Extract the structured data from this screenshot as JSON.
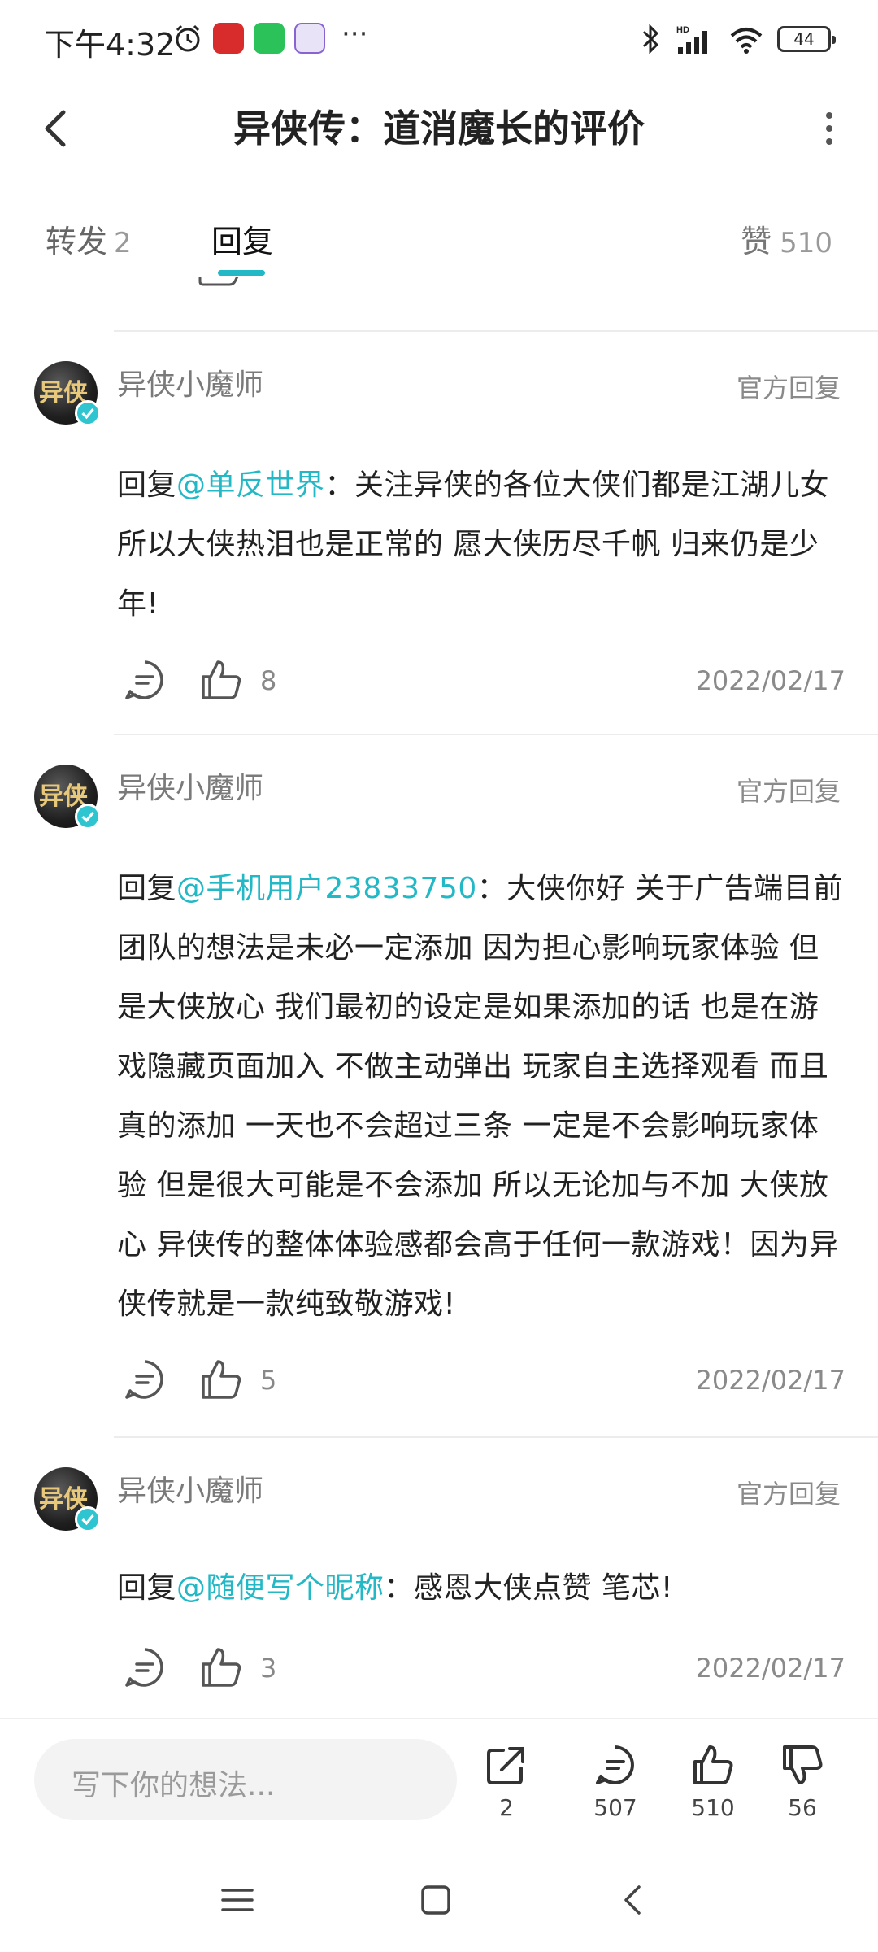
{
  "status_bar": {
    "time": "下午4:32",
    "battery": "44",
    "app_icons": [
      "alarm-icon",
      "app-red-icon",
      "wechat-icon",
      "app-purple-icon"
    ],
    "more": "···",
    "right_icons": [
      "bluetooth-icon",
      "hd-signal-icon",
      "wifi-icon",
      "battery-icon"
    ]
  },
  "header": {
    "title": "异侠传：道消魔长的评价"
  },
  "tabs": {
    "repost_label": "转发",
    "repost_count": "2",
    "reply_label": "回复",
    "like_label": "赞",
    "like_count": "510"
  },
  "comments": [
    {
      "avatar_text": "异侠",
      "username": "异侠小魔师",
      "tag": "官方回复",
      "reply_prefix": "回复",
      "mention": "@单反世界",
      "text": "：关注异侠的各位大侠们都是江湖儿女 所以大侠热泪也是正常的 愿大侠历尽千帆 归来仍是少年!",
      "likes": "8",
      "date": "2022/02/17"
    },
    {
      "avatar_text": "异侠",
      "username": "异侠小魔师",
      "tag": "官方回复",
      "reply_prefix": "回复",
      "mention": "@手机用户23833750",
      "text": "：大侠你好 关于广告端目前团队的想法是未必一定添加 因为担心影响玩家体验 但是大侠放心 我们最初的设定是如果添加的话 也是在游戏隐藏页面加入 不做主动弹出 玩家自主选择观看 而且真的添加 一天也不会超过三条 一定是不会影响玩家体验 但是很大可能是不会添加 所以无论加与不加 大侠放心 异侠传的整体体验感都会高于任何一款游戏！因为异侠传就是一款纯致敬游戏!",
      "likes": "5",
      "date": "2022/02/17"
    },
    {
      "avatar_text": "异侠",
      "username": "异侠小魔师",
      "tag": "官方回复",
      "reply_prefix": "回复",
      "mention": "@随便写个昵称",
      "text": "：感恩大侠点赞 笔芯!",
      "likes": "3",
      "date": "2022/02/17"
    }
  ],
  "bottom_bar": {
    "input_placeholder": "写下你的想法...",
    "share_count": "2",
    "comment_count": "507",
    "like_count": "510",
    "dislike_count": "56"
  },
  "colors": {
    "accent": "#23b8c6",
    "text": "#222222",
    "muted": "#8a8a8a"
  }
}
